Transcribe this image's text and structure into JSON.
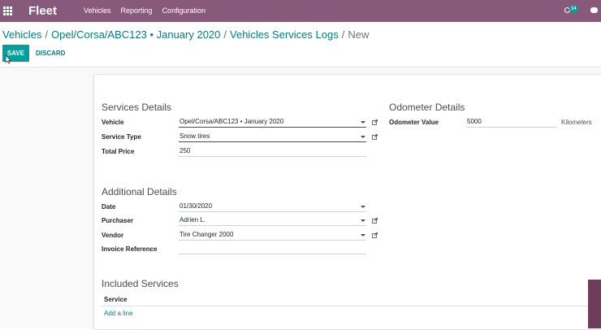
{
  "navbar": {
    "brand": "Fleet",
    "menu": [
      "Vehicles",
      "Reporting",
      "Configuration"
    ],
    "activity_count": "34",
    "color": "#875a7b"
  },
  "breadcrumb": {
    "items": [
      "Vehicles",
      "Opel/Corsa/ABC123 • January 2020",
      "Vehicles Services Logs"
    ],
    "active": "New"
  },
  "buttons": {
    "save": "SAVE",
    "discard": "DISCARD"
  },
  "sections": {
    "services_details": {
      "title": "Services Details",
      "vehicle_label": "Vehicle",
      "vehicle_value": "Opel/Corsa/ABC123 • January 2020",
      "service_type_label": "Service Type",
      "service_type_value": "Snow tires",
      "total_price_label": "Total Price",
      "total_price_value": "250"
    },
    "odometer_details": {
      "title": "Odometer Details",
      "odometer_label": "Odometer Value",
      "odometer_value": "5000",
      "unit": "Kilometers"
    },
    "additional_details": {
      "title": "Additional Details",
      "date_label": "Date",
      "date_value": "01/30/2020",
      "purchaser_label": "Purchaser",
      "purchaser_value": "Adrien L.",
      "vendor_label": "Vendor",
      "vendor_value": "Tire Changer 2000",
      "invoice_label": "Invoice Reference",
      "invoice_value": ""
    },
    "included_services": {
      "title": "Included Services",
      "column_service": "Service",
      "add_line": "Add a line"
    }
  },
  "icons": [
    "apps-icon",
    "activity-clock-icon",
    "chat-icon",
    "external-link-icon",
    "dropdown-caret-icon"
  ]
}
